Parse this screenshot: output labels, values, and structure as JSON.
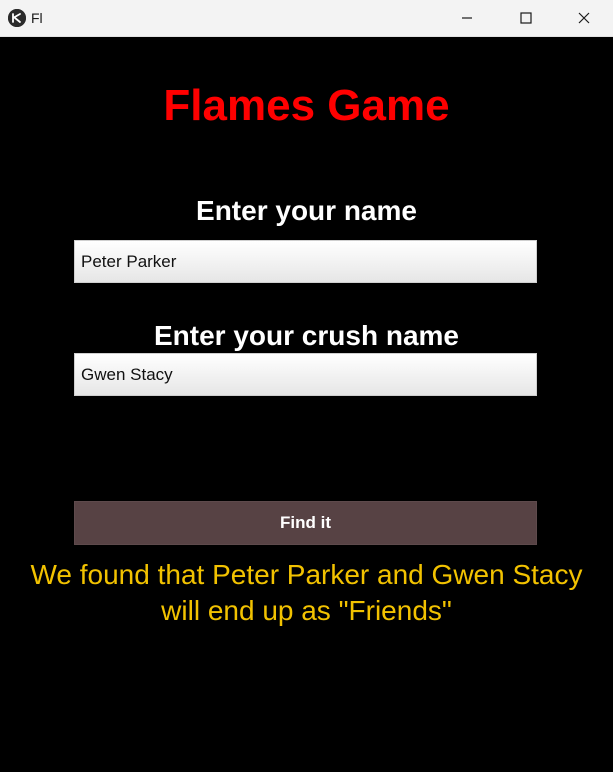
{
  "window": {
    "title": "Fl",
    "icon": "kivy-logo-icon",
    "controls": [
      "minimize-icon",
      "maximize-icon",
      "close-icon"
    ]
  },
  "app": {
    "heading": "Flames Game",
    "name_label": "Enter your name",
    "name_value": "Peter Parker",
    "crush_label": "Enter your crush name",
    "crush_value": "Gwen Stacy",
    "button_label": "Find it",
    "result": "We found that Peter Parker and Gwen Stacy will end up as \"Friends\""
  },
  "colors": {
    "background": "#000000",
    "heading": "#ff0000",
    "labels": "#ffffff",
    "button": "#574244",
    "result": "#f2c200"
  }
}
